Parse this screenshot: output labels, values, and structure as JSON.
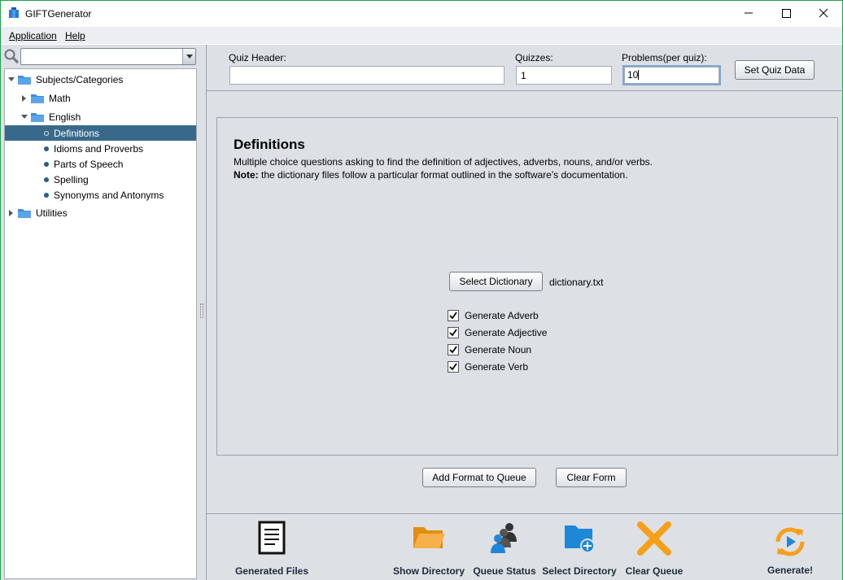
{
  "window": {
    "title": "GIFTGenerator"
  },
  "menu": {
    "items": [
      {
        "label": "Application"
      },
      {
        "label": "Help"
      }
    ]
  },
  "tree": {
    "root": "Subjects/Categories",
    "math": "Math",
    "english": "English",
    "definitions": "Definitions",
    "idioms": "Idioms and Proverbs",
    "parts": "Parts of Speech",
    "spelling": "Spelling",
    "synonyms": "Synonyms and Antonyms",
    "utilities": "Utilities"
  },
  "quiz": {
    "header_label": "Quiz Header:",
    "header_value": "",
    "quizzes_label": "Quizzes:",
    "quizzes_value": "1",
    "problems_label": "Problems(per quiz):",
    "problems_value": "10",
    "set_button": "Set Quiz Data"
  },
  "format": {
    "title": "Definitions",
    "description": "Multiple choice questions asking to find the definition of adjectives, adverbs, nouns, and/or verbs.",
    "note_label": "Note:",
    "note_text": " the dictionary files follow a particular format outlined in the software's documentation.",
    "select_button": "Select Dictionary",
    "dictionary_file": "dictionary.txt",
    "options": [
      {
        "label": "Generate Adverb",
        "checked": true
      },
      {
        "label": "Generate Adjective",
        "checked": true
      },
      {
        "label": "Generate Noun",
        "checked": true
      },
      {
        "label": "Generate Verb",
        "checked": true
      }
    ],
    "add_button": "Add Format to Queue",
    "clear_button": "Clear Form"
  },
  "toolbar": {
    "generated_files": "Generated Files",
    "show_directory": "Show Directory",
    "queue_status": "Queue Status",
    "select_directory": "Select Directory",
    "clear_queue": "Clear Queue",
    "generate": "Generate!"
  },
  "colors": {
    "selection": "#39698a",
    "accent_orange": "#f6a01a",
    "accent_blue": "#1f87d8",
    "window_border": "#1aa34a"
  }
}
